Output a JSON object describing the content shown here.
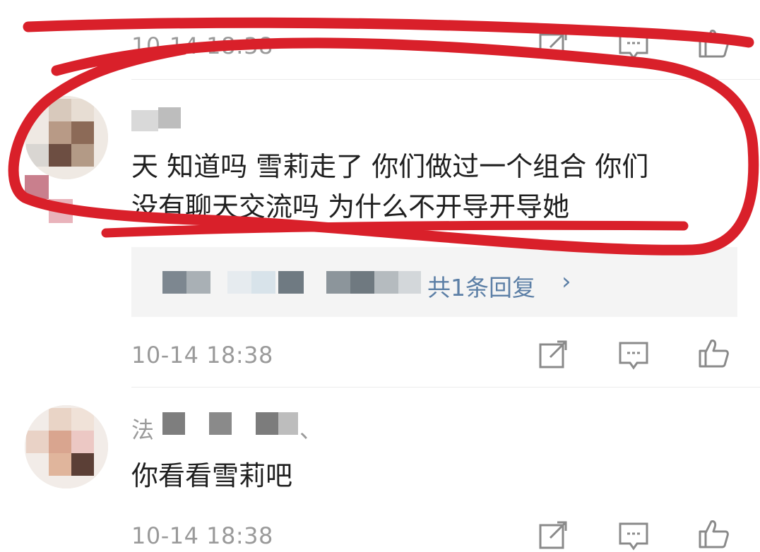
{
  "comments": [
    {
      "author_visible": "",
      "text_line1": "",
      "text_line2": "",
      "timestamp": "10-14 18:38"
    },
    {
      "author_visible": "",
      "text_line1": "天 知道吗 雪莉走了 你们做过一个组合 你们",
      "text_line2": "没有聊天交流吗 为什么不开导开导她",
      "reply_summary": "共1条回复",
      "reply_chevron": "›",
      "timestamp": "10-14 18:38"
    },
    {
      "author_visible": "法",
      "author_suffix": "、",
      "text_line1": "你看看雪莉吧",
      "timestamp": "10-14 18:38"
    }
  ],
  "icons": {
    "share": "share-icon",
    "comment": "comment-icon",
    "like": "thumbs-up-icon"
  },
  "colors": {
    "annotation": "#d9202a",
    "link": "#5c7fa6",
    "timestamp": "#9a9a9a"
  }
}
